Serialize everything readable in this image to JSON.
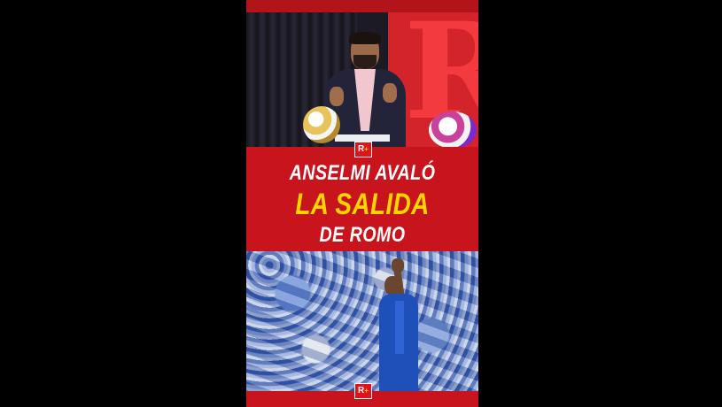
{
  "video": {
    "headline": {
      "line1": "ANSELMI AVALÓ",
      "line2": "LA SALIDA",
      "line3": "DE ROMO"
    },
    "brand_logo": {
      "letter": "R",
      "plus": "+"
    },
    "colors": {
      "background": "#000000",
      "brand_red": "#c8141c",
      "headline_yellow": "#ffd500",
      "headline_white": "#ffffff",
      "jersey_blue": "#1f4fb8"
    }
  }
}
